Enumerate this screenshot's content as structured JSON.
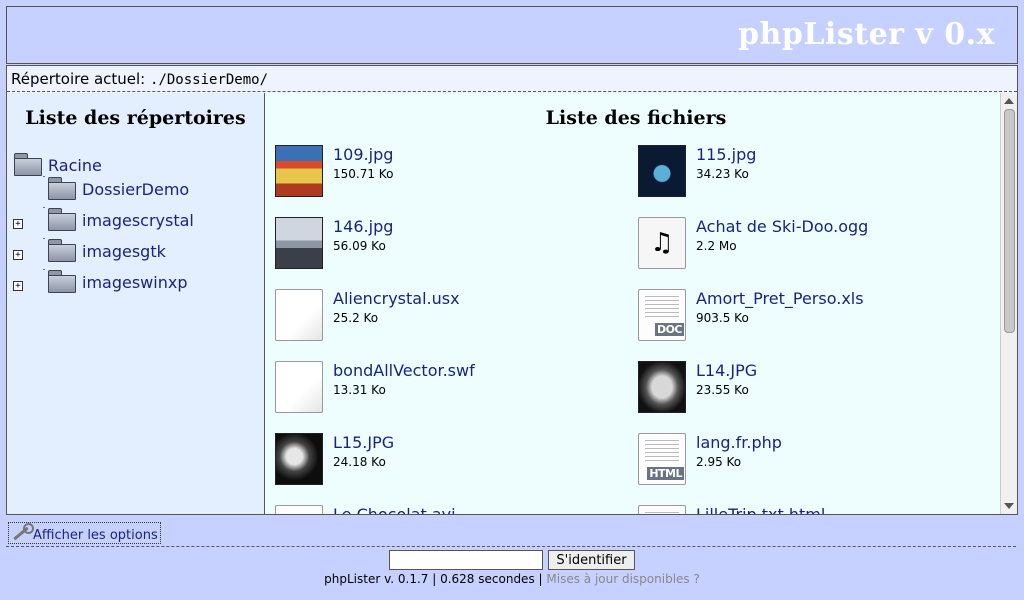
{
  "header": {
    "title": "phpLister v 0.x"
  },
  "path_bar": {
    "label": "Répertoire actuel:",
    "value": "./DossierDemo/"
  },
  "directory_pane": {
    "title": "Liste des répertoires",
    "root": {
      "label": "Racine",
      "icon": "folder-icon"
    },
    "children": [
      {
        "label": "DossierDemo",
        "icon": "folder-icon",
        "expandable": false
      },
      {
        "label": "imagescrystal",
        "icon": "folder-icon",
        "expandable": true
      },
      {
        "label": "imagesgtk",
        "icon": "folder-icon",
        "expandable": true
      },
      {
        "label": "imageswinxp",
        "icon": "folder-icon",
        "expandable": true
      }
    ],
    "expander_symbol": "+"
  },
  "file_pane": {
    "title": "Liste des fichiers",
    "files": [
      {
        "name": "109.jpg",
        "size": "150.71 Ko",
        "icon": "image-thumbnail"
      },
      {
        "name": "115.jpg",
        "size": "34.23 Ko",
        "icon": "image-thumbnail"
      },
      {
        "name": "146.jpg",
        "size": "56.09 Ko",
        "icon": "image-thumbnail"
      },
      {
        "name": "Achat de Ski-Doo.ogg",
        "size": "2.2 Mo",
        "icon": "audio-file-icon"
      },
      {
        "name": "Aliencrystal.usx",
        "size": "25.2 Ko",
        "icon": "blank-file-icon"
      },
      {
        "name": "Amort_Pret_Perso.xls",
        "size": "903.5 Ko",
        "icon": "doc-file-icon",
        "badge": "DOC"
      },
      {
        "name": "bondAllVector.swf",
        "size": "13.31 Ko",
        "icon": "blank-file-icon"
      },
      {
        "name": "L14.JPG",
        "size": "23.55 Ko",
        "icon": "image-thumbnail"
      },
      {
        "name": "L15.JPG",
        "size": "24.18 Ko",
        "icon": "image-thumbnail"
      },
      {
        "name": "lang.fr.php",
        "size": "2.95 Ko",
        "icon": "html-file-icon",
        "badge": "HTML"
      },
      {
        "name": "Le Chocolat.avi",
        "size": "",
        "icon": "blank-file-icon"
      },
      {
        "name": "LilleTrip.txt.html",
        "size": "",
        "icon": "doc-file-icon"
      }
    ]
  },
  "options": {
    "label": "Afficher les options",
    "icon": "wrench-icon"
  },
  "login": {
    "input_value": "",
    "button_label": "S'identifier"
  },
  "footer": {
    "version_text": "phpLister v. 0.1.7 | 0.628 secondes |",
    "update_link": "Mises à jour disponibles ?"
  },
  "colors": {
    "background": "#c6d1ff",
    "link": "#1a237e",
    "dir_pane": "#e3eefe",
    "file_pane": "#eefeff"
  }
}
